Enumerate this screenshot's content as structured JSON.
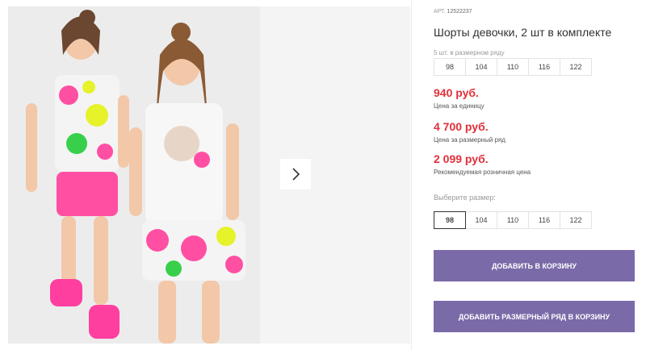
{
  "product": {
    "article_label": "АРТ.",
    "article_number": "12522237",
    "title": "Шорты девочки, 2 шт в комплекте"
  },
  "size_row": {
    "label": "5 шт. в размерном ряду",
    "sizes": [
      "98",
      "104",
      "110",
      "116",
      "122"
    ]
  },
  "prices": {
    "unit_price": "940 руб.",
    "unit_label": "Цена за единицу",
    "row_price": "4 700 руб.",
    "row_label": "Цена за размерный ряд",
    "retail_price": "2 099 руб.",
    "retail_label": "Рекомендуемая розничная цена"
  },
  "size_picker": {
    "label": "Выберите размер:",
    "sizes": [
      "98",
      "104",
      "110",
      "116",
      "122"
    ],
    "selected": "98"
  },
  "buttons": {
    "add_to_cart": "ДОБАВИТЬ В КОРЗИНУ",
    "add_row_to_cart": "ДОБАВИТЬ РАЗМЕРНЫЙ РЯД В КОРЗИНУ"
  },
  "colors": {
    "price": "#e0303b",
    "button": "#7b6aa8",
    "shorts_pink": "#ff4fa3"
  },
  "icons": {
    "next": "chevron-right-icon"
  }
}
